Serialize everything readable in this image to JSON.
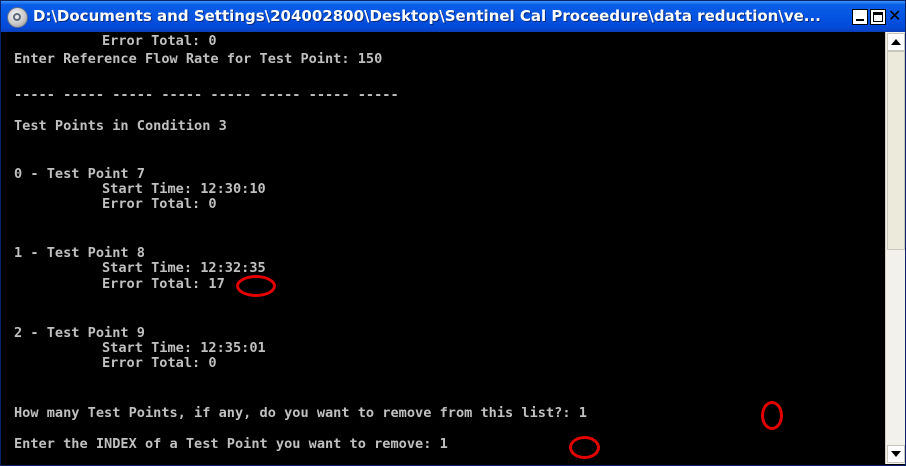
{
  "window": {
    "title": "D:\\Documents and Settings\\204002800\\Desktop\\Sentinel Cal Proceedure\\data reduction\\ve...",
    "controls": {
      "minimize": "minimize",
      "maximize": "maximize",
      "close": "✕"
    }
  },
  "console": {
    "lines": [
      "Error Total: 0",
      "Enter Reference Flow Rate for Test Point: 150",
      "",
      "----- ----- ----- ----- ----- ----- ----- -----",
      "Test Points in Condition 3",
      "",
      "",
      "0 - Test Point 7",
      "Start Time: 12:30:10",
      "Error Total: 0",
      "",
      "",
      "1 - Test Point 8",
      "Start Time: 12:32:35",
      "Error Total: 17",
      "",
      "",
      "2 - Test Point 9",
      "Start Time: 12:35:01",
      "Error Total: 0",
      "",
      "",
      "How many Test Points, if any, do you want to remove from this list?: 1",
      "",
      "Enter the INDEX of a Test Point you want to remove: 1"
    ]
  },
  "scrollbar": {
    "up_icon": "arrow-up-icon",
    "down_icon": "arrow-down-icon",
    "thumb_position": 0.0
  },
  "annotations": {
    "color": "#e30000",
    "shape": "red-circle"
  }
}
